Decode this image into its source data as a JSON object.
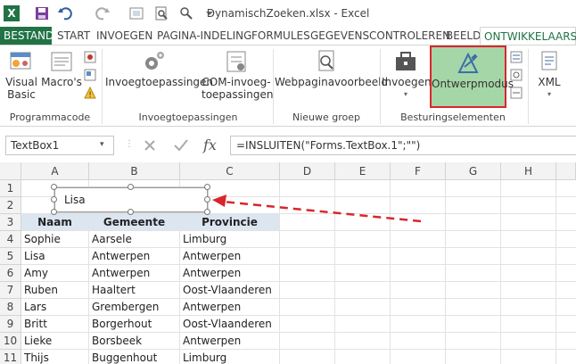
{
  "window": {
    "title": "DynamischZoeken.xlsx - Excel"
  },
  "tabs": [
    "BESTAND",
    "START",
    "INVOEGEN",
    "PAGINA-INDELING",
    "FORMULES",
    "GEGEVENS",
    "CONTROLEREN",
    "BEELD",
    "ONTWIKKELAARS"
  ],
  "ribbon": {
    "visual_basic": "Visual Basic",
    "macros": "Macro's",
    "group_code": "Programmacode",
    "addins": "Invoegtoepassingen",
    "com_addins": "COM-invoeg-toepassingen",
    "group_addins": "Invoegtoepassingen",
    "web_preview": "Webpaginavoorbeeld",
    "group_new": "Nieuwe groep",
    "insert": "Invoegen",
    "design_mode": "Ontwerpmodus",
    "xml": "XML",
    "group_controls": "Besturingselementen"
  },
  "formula_bar": {
    "name_box": "TextBox1",
    "formula": "=INSLUITEN(\"Forms.TextBox.1\";\"\")",
    "fx": "fx"
  },
  "grid": {
    "columns": [
      "A",
      "B",
      "C",
      "D",
      "E",
      "F",
      "G",
      "H"
    ],
    "rows": [
      "1",
      "2",
      "3",
      "4",
      "5",
      "6",
      "7",
      "8",
      "9",
      "10",
      "11"
    ],
    "textbox_value": "Lisa",
    "headers": [
      "Naam",
      "Gemeente",
      "Provincie"
    ],
    "data": [
      [
        "Sophie",
        "Aarsele",
        "Limburg"
      ],
      [
        "Lisa",
        "Antwerpen",
        "Antwerpen"
      ],
      [
        "Amy",
        "Antwerpen",
        "Antwerpen"
      ],
      [
        "Ruben",
        "Haaltert",
        "Oost-Vlaanderen"
      ],
      [
        "Lars",
        "Grembergen",
        "Antwerpen"
      ],
      [
        "Britt",
        "Borgerhout",
        "Oost-Vlaanderen"
      ],
      [
        "Lieke",
        "Borsbeek",
        "Antwerpen"
      ],
      [
        "Thijs",
        "Buggenhout",
        "Limburg"
      ]
    ]
  },
  "colors": {
    "accent": "#217346",
    "highlight_border": "#d9262b",
    "highlight_fill": "#a5d6a7",
    "arrow": "#d9262b"
  }
}
